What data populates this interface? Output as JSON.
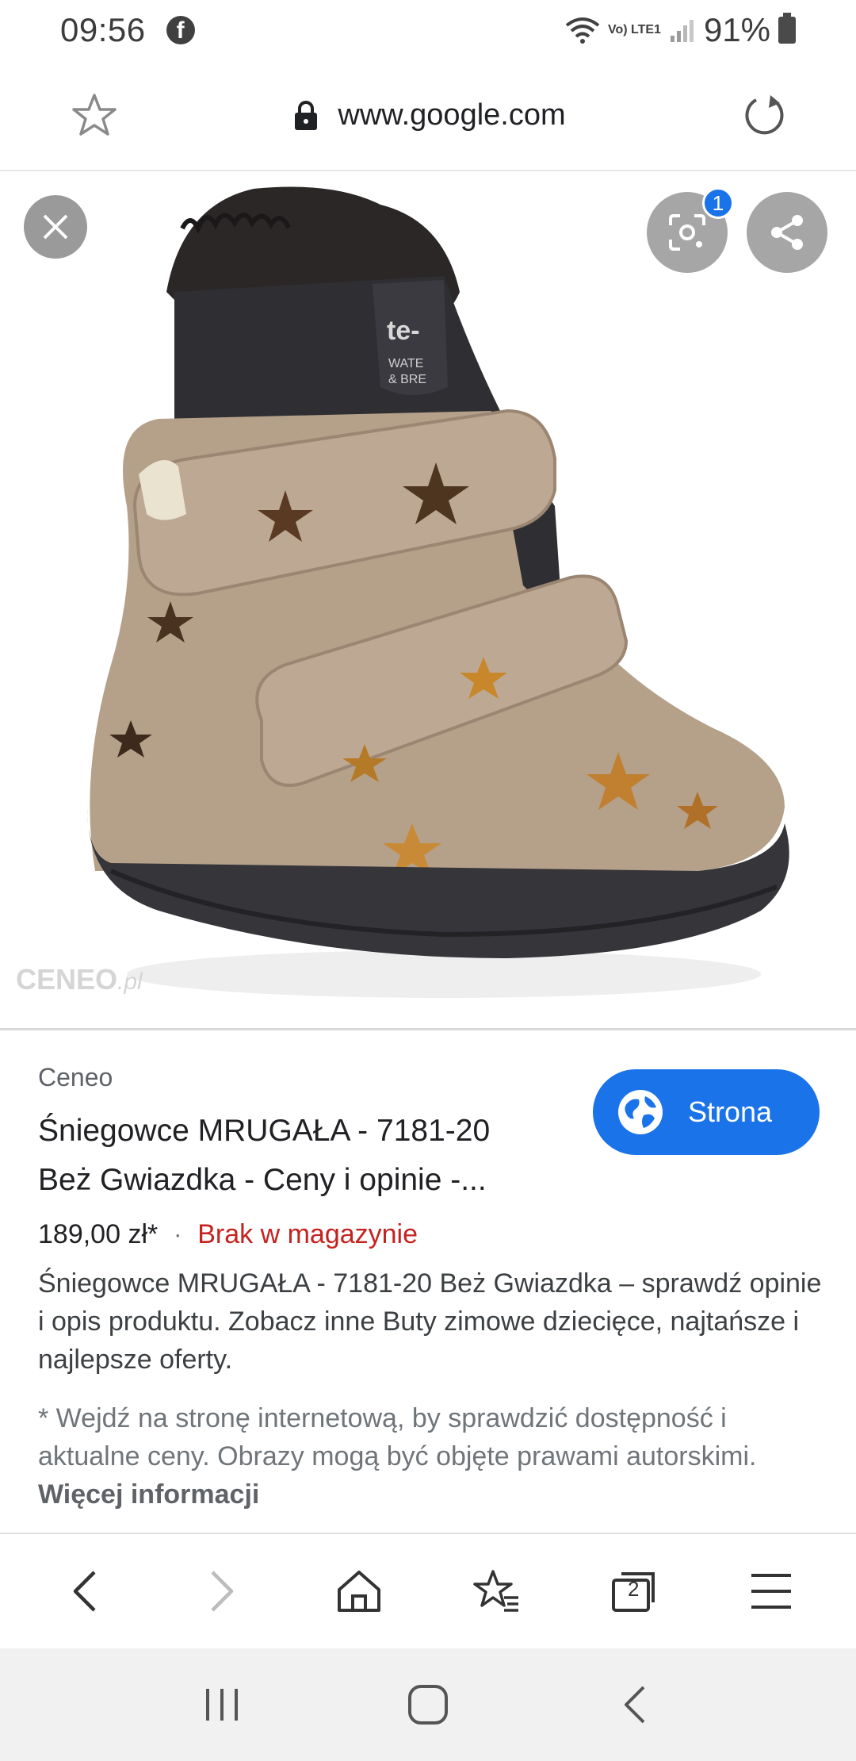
{
  "status_bar": {
    "time": "09:56",
    "battery": "91%",
    "network_label": "Vo) LTE1",
    "icons": [
      "facebook-icon",
      "wifi-icon",
      "signal-icon",
      "battery-icon"
    ]
  },
  "url_bar": {
    "url": "www.google.com",
    "icons": [
      "star-icon",
      "lock-icon",
      "reload-icon"
    ]
  },
  "image_viewer": {
    "lens_badge_count": "1",
    "watermark_main": "CENEO",
    "watermark_suffix": ".pl",
    "icons": [
      "close-icon",
      "lens-icon",
      "share-icon"
    ]
  },
  "result": {
    "source": "Ceneo",
    "title_line1": "Śniegowce MRUGAŁA - 7181-20",
    "title_line2": "Beż Gwiazdka - Ceny i opinie -...",
    "visit_button": "Strona",
    "price": "189,00 zł*",
    "separator": "·",
    "stock_status": "Brak w magazynie",
    "description": "Śniegowce MRUGAŁA - 7181-20 Beż Gwiazdka – sprawdź opinie i opis produktu. Zobacz inne Buty zimowe dziecięce, najtańsze i najlepsze oferty.",
    "note": "* Wejdź na stronę internetową, by sprawdzić dostępność i aktualne ceny. Obrazy mogą być objęte prawami autorskimi.",
    "note_link": "Więcej informacji"
  },
  "browser_nav": {
    "tabs_count": "2",
    "icons": [
      "back-icon",
      "forward-icon",
      "home-icon",
      "bookmarks-icon",
      "tabs-icon",
      "menu-icon"
    ]
  },
  "system_nav": {
    "icons": [
      "recents-icon",
      "home-circle-icon",
      "system-back-icon"
    ]
  },
  "colors": {
    "accent": "#1a73e8",
    "stock_red": "#c5221f",
    "text": "#202124",
    "muted": "#70757a"
  }
}
